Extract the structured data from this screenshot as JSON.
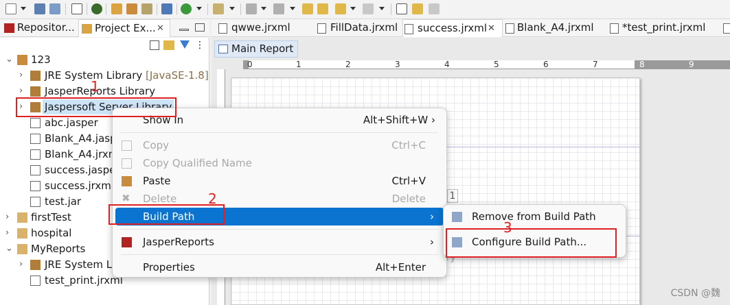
{
  "left_tabs": [
    {
      "label": "Repositor...",
      "active": false
    },
    {
      "label": "Project Ex...",
      "active": true,
      "close": "✕"
    }
  ],
  "tree": [
    {
      "label": "123",
      "twisty": "⌄"
    },
    {
      "label": "JRE System Library",
      "decoration": "[JavaSE-1.8]",
      "twisty": "›"
    },
    {
      "label": "JasperReports Library",
      "twisty": "›"
    },
    {
      "label": "Jaspersoft Server Library",
      "twisty": "›",
      "selected": true
    },
    {
      "label": "abc.jasper"
    },
    {
      "label": "Blank_A4.jasper"
    },
    {
      "label": "Blank_A4.jrxml"
    },
    {
      "label": "success.jasper"
    },
    {
      "label": "success.jrxml"
    },
    {
      "label": "test.jar"
    },
    {
      "label": "firstTest",
      "twisty": "›"
    },
    {
      "label": "hospital",
      "twisty": "›"
    },
    {
      "label": "MyReports",
      "twisty": "⌄"
    },
    {
      "label": "JRE System Library",
      "twisty": "›"
    },
    {
      "label": "test_print.jrxml"
    }
  ],
  "editor_tabs": [
    {
      "label": "qwwe.jrxml"
    },
    {
      "label": "FillData.jrxml"
    },
    {
      "label": "success.jrxml",
      "active": true,
      "close": "✕"
    },
    {
      "label": "Blank_A4.jrxml"
    },
    {
      "label": "*test_print.jrxml"
    }
  ],
  "editor": {
    "subtab": "Main Report",
    "ruler": [
      "0",
      "1",
      "2",
      "3",
      "4",
      "5",
      "6",
      "7",
      "8",
      "9"
    ],
    "ghost_number": "1",
    "ghost_text": "ry"
  },
  "context_menu": [
    {
      "label": "Show In",
      "shortcut": "Alt+Shift+W ›",
      "enabled": true
    },
    {
      "label": "Copy",
      "shortcut": "Ctrl+C",
      "enabled": false
    },
    {
      "label": "Copy Qualified Name",
      "shortcut": "",
      "enabled": false
    },
    {
      "label": "Paste",
      "shortcut": "Ctrl+V",
      "enabled": true
    },
    {
      "label": "Delete",
      "shortcut": "Delete",
      "enabled": false
    },
    {
      "label": "Build Path",
      "shortcut": "›",
      "enabled": true,
      "highlighted": true
    },
    {
      "label": "JasperReports",
      "shortcut": "›",
      "enabled": true
    },
    {
      "label": "Properties",
      "shortcut": "Alt+Enter",
      "enabled": true
    }
  ],
  "submenu": [
    {
      "label": "Remove from Build Path"
    },
    {
      "label": "Configure Build Path..."
    }
  ],
  "annotations": [
    "1",
    "2",
    "3"
  ],
  "watermark": "CSDN @魏𥅴",
  "colors": {
    "highlight": "#0a74d0",
    "annotation": "#e02020"
  }
}
